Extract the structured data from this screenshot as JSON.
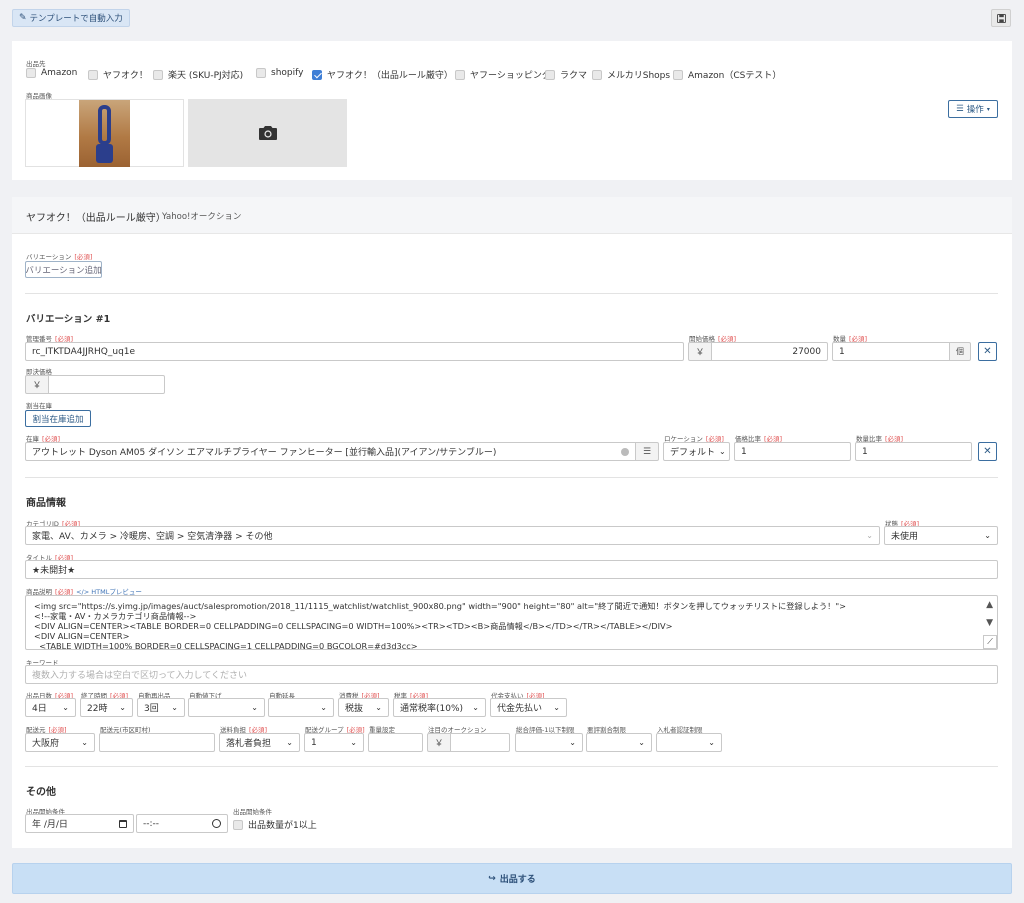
{
  "toolbar": {
    "template_btn": "テンプレートで自動入力"
  },
  "top": {
    "dest_label": "出品先",
    "destinations": [
      {
        "label": "Amazon",
        "checked": false
      },
      {
        "label": "ヤフオク！",
        "checked": false
      },
      {
        "label": "楽天 (SKU-PJ対応)",
        "checked": false
      },
      {
        "label": "shopify",
        "checked": false
      },
      {
        "label": "ヤフオク！（出品ルール厳守）",
        "checked": true
      },
      {
        "label": "ヤフーショッピング",
        "checked": false
      },
      {
        "label": "ラクマ",
        "checked": false
      },
      {
        "label": "メルカリShops",
        "checked": false
      },
      {
        "label": "Amazon（CSテスト）",
        "checked": false
      }
    ],
    "image_label": "商品画像",
    "ops_btn": "操作"
  },
  "section": {
    "title": "ヤフオク！（出品ルール厳守）",
    "subtitle": "Yahoo!オークション"
  },
  "required": "[必須]",
  "variation": {
    "label": "バリエーション",
    "add_btn": "バリエーション追加",
    "heading": "バリエーション #1",
    "mgmt_label": "管理番号",
    "mgmt_value": "rc_ITKTDA4JJRHQ_uq1e",
    "start_price_label": "開始価格",
    "yen": "￥",
    "start_price_value": "27000",
    "qty_label": "数量",
    "qty_value": "1",
    "qty_unit": "個",
    "buyout_label": "即決価格",
    "alloc_label": "割当在庫",
    "alloc_btn": "割当在庫追加",
    "stock_label": "在庫",
    "stock_value": "アウトレット Dyson AM05 ダイソン エアマルチプライヤー ファンヒーター [並行輸入品](アイアン/サテンブルー)",
    "loc_label": "ロケーション",
    "loc_value": "デフォルト",
    "price_ratio_label": "価格比率",
    "price_ratio_value": "1",
    "qty_ratio_label": "数量比率",
    "qty_ratio_value": "1"
  },
  "product": {
    "heading": "商品情報",
    "cat_label": "カテゴリID",
    "cat_value": "家電、AV、カメラ > 冷暖房、空調 > 空気清浄器 > その他",
    "cond_label": "状態",
    "cond_value": "未使用",
    "title_label": "タイトル",
    "title_value": "★未開封★",
    "desc_label": "商品説明",
    "desc_preview": "</> HTMLプレビュー",
    "desc_lines": [
      "<img src=\"https://s.yimg.jp/images/auct/salespromotion/2018_11/1115_watchlist/watchlist_900x80.png\" width=\"900\" height=\"80\" alt=\"終了間近で通知！ボタンを押してウォッチリストに登録しよう！\">",
      "<!--家電・AV・カメラカテゴリ商品情報-->",
      "<DIV ALIGN=CENTER><TABLE BORDER=0 CELLPADDING=0 CELLSPACING=0 WIDTH=100%><TR><TD><B>商品情報</B></TD></TR></TABLE></DIV>",
      "<DIV ALIGN=CENTER>",
      "  <TABLE WIDTH=100% BORDER=0 CELLSPACING=1 CELLPADDING=0 BGCOLOR=#d3d3cc>"
    ],
    "kw_label": "キーワード",
    "kw_placeholder": "複数入力する場合は空白で区切って入力してください",
    "days_label": "出品日数",
    "days_value": "4日",
    "end_label": "終了時間",
    "end_value": "22時",
    "relist_label": "自動再出品",
    "relist_value": "3回",
    "pricedown_label": "自動値下げ",
    "pricedown_value": "",
    "extend_label": "自動延長",
    "extend_value": "",
    "tax_label": "消費税",
    "tax_value": "税抜",
    "taxrate_label": "税率",
    "taxrate_value": "通常税率(10%)",
    "cod_label": "代金支払い",
    "cod_value": "代金先払い",
    "ship_from_label": "配送元",
    "ship_from_value": "大阪府",
    "ship_city_label": "配送元(市区町村)",
    "ship_fee_label": "送料負担",
    "ship_fee_value": "落札者負担",
    "ship_group_label": "配送グループ",
    "ship_group_value": "1",
    "weight_label": "重量設定",
    "featured_label": "注目のオークション",
    "rating_label": "総合評価-1以下制限",
    "bad_ratio_label": "悪評割合制限",
    "bidder_auth_label": "入札者認証制限"
  },
  "other": {
    "heading": "その他",
    "start_cond_label": "出品開始条件",
    "date_placeholder": "年 /月/日",
    "time_placeholder": "--:--",
    "start_cond2_label": "出品開始条件",
    "qty_cond": "出品数量が1以上"
  },
  "submit": {
    "label": "出品する"
  }
}
